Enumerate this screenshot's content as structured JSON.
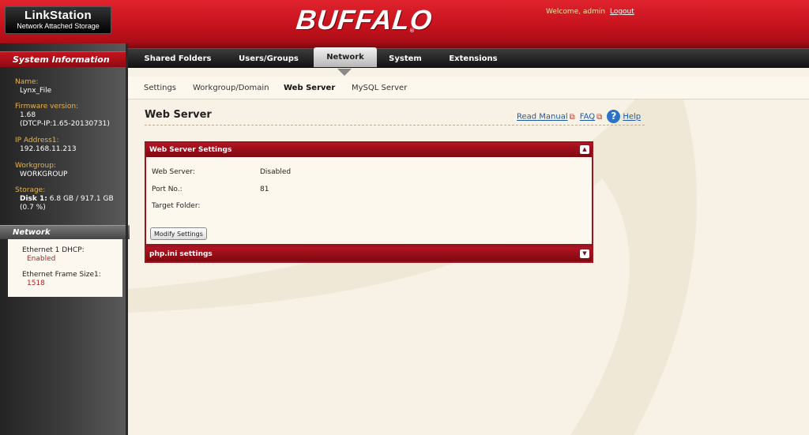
{
  "header": {
    "product_name": "LinkStation",
    "product_sub": "Network Attached Storage",
    "brand": "BUFFALO",
    "brand_mark": "®",
    "welcome_text": "Welcome, admin",
    "logout_label": "Logout"
  },
  "main_nav": {
    "tabs": [
      {
        "label": "Shared Folders",
        "active": false
      },
      {
        "label": "Users/Groups",
        "active": false
      },
      {
        "label": "Network",
        "active": true
      },
      {
        "label": "System",
        "active": false
      },
      {
        "label": "Extensions",
        "active": false
      }
    ]
  },
  "sub_nav": {
    "tabs": [
      {
        "label": "Settings",
        "active": false
      },
      {
        "label": "Workgroup/Domain",
        "active": false
      },
      {
        "label": "Web Server",
        "active": true
      },
      {
        "label": "MySQL Server",
        "active": false
      }
    ]
  },
  "sidebar": {
    "system_info_title": "System Information",
    "name_label": "Name:",
    "name_value": "Lynx_File",
    "firmware_label": "Firmware version:",
    "firmware_value": "1.68",
    "firmware_detail": "(DTCP-IP:1.65-20130731)",
    "ip_label": "IP Address1:",
    "ip_value": "192.168.11.213",
    "workgroup_label": "Workgroup:",
    "workgroup_value": "WORKGROUP",
    "storage_label": "Storage:",
    "storage_disk": "Disk 1:",
    "storage_value": "6.8 GB / 917.1 GB",
    "storage_percent": "(0.7 %)",
    "network_title": "Network",
    "dhcp_label": "Ethernet 1 DHCP:",
    "dhcp_value": "Enabled",
    "frame_label": "Ethernet Frame Size1:",
    "frame_value": "1518"
  },
  "content": {
    "page_title": "Web Server",
    "read_manual": "Read Manual",
    "faq": "FAQ",
    "help": "Help",
    "help_icon_glyph": "?",
    "ext_icon_glyph": "⧉",
    "panel_title": "Web Server Settings",
    "fields": [
      {
        "label": "Web Server:",
        "value": "Disabled"
      },
      {
        "label": "Port No.:",
        "value": "81"
      },
      {
        "label": "Target Folder:",
        "value": ""
      }
    ],
    "modify_button": "Modify Settings",
    "php_panel_title": "php.ini settings",
    "collapse_up": "▲",
    "collapse_down": "▼"
  },
  "colors": {
    "brand_red": "#c5121d",
    "panel_red": "#9c1420",
    "label_gold": "#e6b552",
    "link_blue": "#1a5aa8",
    "page_bg": "#f8f2e6"
  }
}
